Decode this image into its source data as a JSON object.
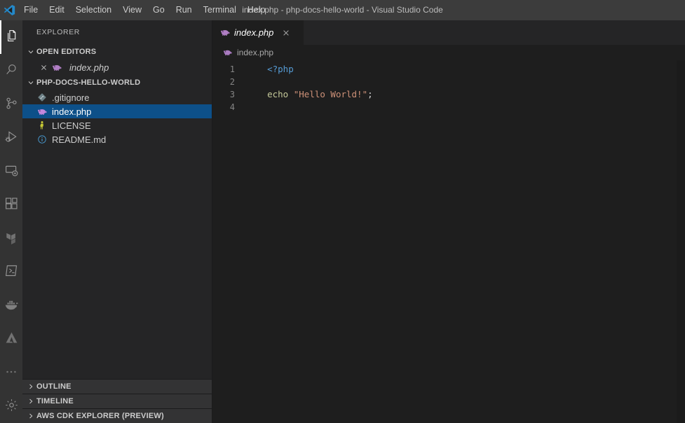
{
  "window": {
    "title": "index.php - php-docs-hello-world - Visual Studio Code",
    "logo_icon": "vscode-logo-icon"
  },
  "menubar": {
    "items": [
      {
        "label": "File"
      },
      {
        "label": "Edit"
      },
      {
        "label": "Selection"
      },
      {
        "label": "View"
      },
      {
        "label": "Go"
      },
      {
        "label": "Run"
      },
      {
        "label": "Terminal"
      },
      {
        "label": "Help"
      }
    ]
  },
  "activitybar": {
    "items": [
      {
        "name": "explorer",
        "icon": "files-icon",
        "active": true
      },
      {
        "name": "search",
        "icon": "search-icon",
        "active": false
      },
      {
        "name": "source-control",
        "icon": "source-control-icon",
        "active": false
      },
      {
        "name": "run-and-debug",
        "icon": "run-and-debug-icon",
        "active": false
      },
      {
        "name": "remote-explorer",
        "icon": "remote-explorer-icon",
        "active": false
      },
      {
        "name": "extensions",
        "icon": "extensions-icon",
        "active": false
      },
      {
        "name": "terraform",
        "icon": "terraform-icon",
        "active": false
      },
      {
        "name": "azure-terminal",
        "icon": "powershell-terminal-icon",
        "active": false
      },
      {
        "name": "docker",
        "icon": "docker-whale-icon",
        "active": false
      },
      {
        "name": "azure",
        "icon": "azure-icon",
        "active": false
      },
      {
        "name": "additional-views",
        "icon": "ellipsis-icon",
        "active": false
      }
    ],
    "bottom": [
      {
        "name": "manage",
        "icon": "gear-icon"
      }
    ]
  },
  "sidebar": {
    "title": "EXPLORER",
    "open_editors": {
      "label": "OPEN EDITORS",
      "expanded": true,
      "twisty_icon": "chevron-down-icon",
      "items": [
        {
          "name": "index.php",
          "icon": "php-elephant-icon",
          "close_icon": "close-icon",
          "dirty": false
        }
      ]
    },
    "folder": {
      "label": "PHP-DOCS-HELLO-WORLD",
      "expanded": true,
      "twisty_icon": "chevron-down-icon",
      "files": [
        {
          "name": ".gitignore",
          "icon": "git-icon",
          "selected": false
        },
        {
          "name": "index.php",
          "icon": "php-elephant-icon",
          "selected": true
        },
        {
          "name": "LICENSE",
          "icon": "license-icon",
          "selected": false
        },
        {
          "name": "README.md",
          "icon": "info-markdown-icon",
          "selected": false
        }
      ]
    },
    "bottom_sections": [
      {
        "label": "OUTLINE",
        "expanded": false,
        "twisty_icon": "chevron-right-icon"
      },
      {
        "label": "TIMELINE",
        "expanded": false,
        "twisty_icon": "chevron-right-icon"
      },
      {
        "label": "AWS CDK EXPLORER (PREVIEW)",
        "expanded": false,
        "twisty_icon": "chevron-right-icon"
      }
    ]
  },
  "editor": {
    "tabs": [
      {
        "label": "index.php",
        "icon": "php-elephant-icon",
        "close_icon": "close-icon",
        "preview": true,
        "active": true
      }
    ],
    "breadcrumb": {
      "icon": "php-elephant-icon",
      "label": "index.php"
    },
    "line_numbers": [
      "1",
      "2",
      "3",
      "4"
    ],
    "lines": [
      {
        "segments": [
          {
            "text": "    ",
            "type": "plain"
          },
          {
            "text": "<?php",
            "type": "tag"
          }
        ]
      },
      {
        "segments": [
          {
            "text": "",
            "type": "plain"
          }
        ]
      },
      {
        "segments": [
          {
            "text": "    ",
            "type": "plain"
          },
          {
            "text": "echo",
            "type": "keyword"
          },
          {
            "text": " ",
            "type": "plain"
          },
          {
            "text": "\"Hello World!\"",
            "type": "string"
          },
          {
            "text": ";",
            "type": "punct"
          }
        ]
      },
      {
        "segments": [
          {
            "text": "",
            "type": "plain"
          }
        ]
      }
    ]
  },
  "colors": {
    "titlebar_bg": "#3c3c3c",
    "activitybar_bg": "#333333",
    "sidebar_bg": "#252526",
    "editor_bg": "#1e1e1e",
    "selection_bg": "#0d5089",
    "accent_blue": "#569cd6",
    "string_orange": "#ce9178",
    "keyword_yellow": "#c5c99a",
    "php_purple": "#b07ec4",
    "logo_blue": "#2489ca"
  }
}
